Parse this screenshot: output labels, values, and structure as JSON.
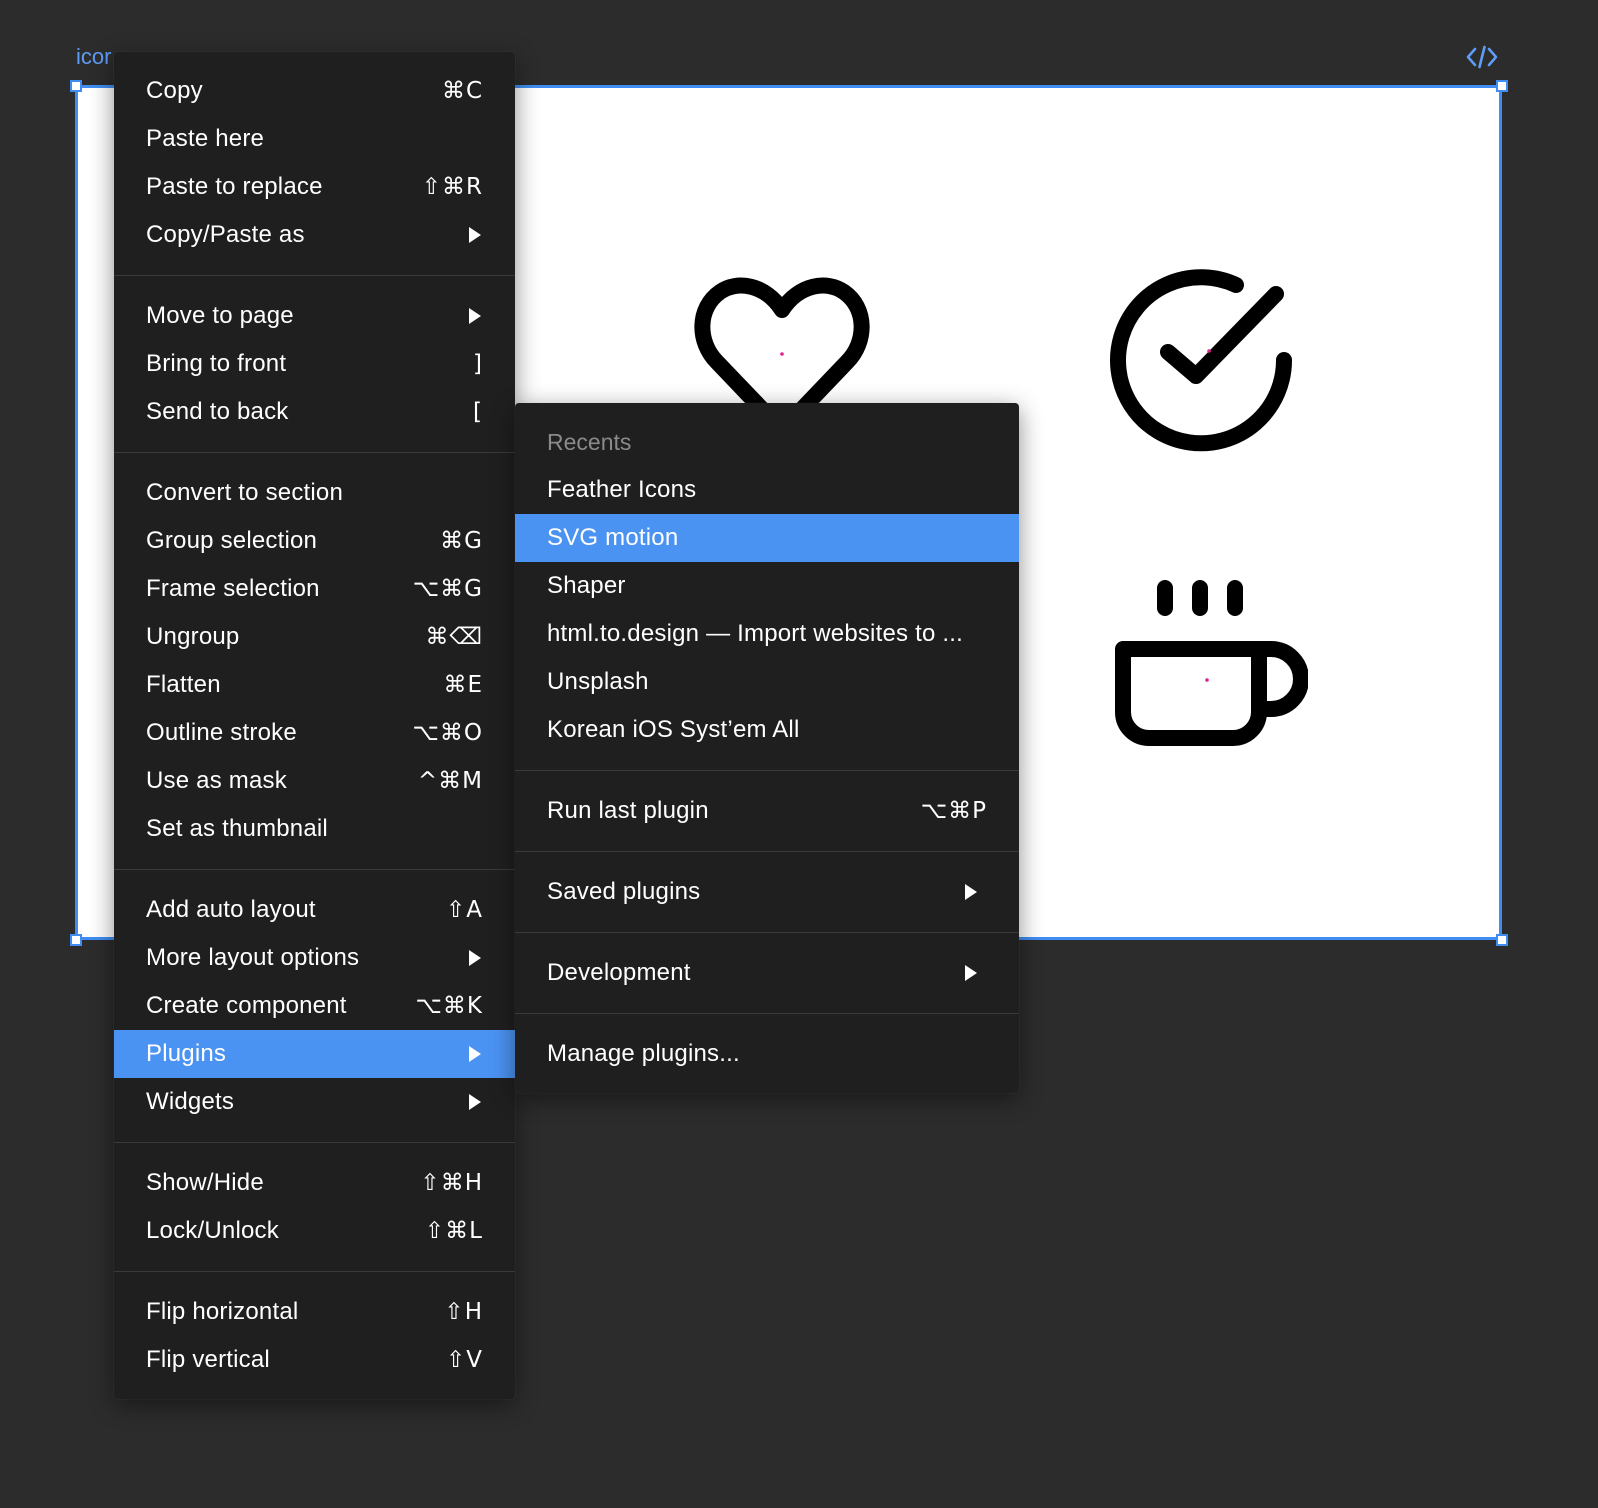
{
  "frame": {
    "label": "icor",
    "code_icon": "code-icon",
    "icons": [
      "heart-icon",
      "check-circle-icon",
      "coffee-icon"
    ]
  },
  "context_menu": {
    "groups": [
      [
        {
          "label": "Copy",
          "shortcut": "⌘C"
        },
        {
          "label": "Paste here",
          "shortcut": ""
        },
        {
          "label": "Paste to replace",
          "shortcut": "⇧⌘R"
        },
        {
          "label": "Copy/Paste as",
          "submenu": true
        }
      ],
      [
        {
          "label": "Move to page",
          "submenu": true
        },
        {
          "label": "Bring to front",
          "shortcut": "]"
        },
        {
          "label": "Send to back",
          "shortcut": "["
        }
      ],
      [
        {
          "label": "Convert to section",
          "shortcut": ""
        },
        {
          "label": "Group selection",
          "shortcut": "⌘G"
        },
        {
          "label": "Frame selection",
          "shortcut": "⌥⌘G"
        },
        {
          "label": "Ungroup",
          "shortcut": "⌘⌫"
        },
        {
          "label": "Flatten",
          "shortcut": "⌘E"
        },
        {
          "label": "Outline stroke",
          "shortcut": "⌥⌘O"
        },
        {
          "label": "Use as mask",
          "shortcut": "^⌘M"
        },
        {
          "label": "Set as thumbnail",
          "shortcut": ""
        }
      ],
      [
        {
          "label": "Add auto layout",
          "shortcut": "⇧A"
        },
        {
          "label": "More layout options",
          "submenu": true
        },
        {
          "label": "Create component",
          "shortcut": "⌥⌘K"
        },
        {
          "label": "Plugins",
          "submenu": true,
          "active": true
        },
        {
          "label": "Widgets",
          "submenu": true
        }
      ],
      [
        {
          "label": "Show/Hide",
          "shortcut": "⇧⌘H"
        },
        {
          "label": "Lock/Unlock",
          "shortcut": "⇧⌘L"
        }
      ],
      [
        {
          "label": "Flip horizontal",
          "shortcut": "⇧H"
        },
        {
          "label": "Flip vertical",
          "shortcut": "⇧V"
        }
      ]
    ]
  },
  "plugins_menu": {
    "recents_heading": "Recents",
    "recents": [
      {
        "label": "Feather Icons"
      },
      {
        "label": "SVG motion",
        "active": true
      },
      {
        "label": "Shaper"
      },
      {
        "label": "html.to.design — Import websites to ..."
      },
      {
        "label": "Unsplash"
      },
      {
        "label": "Korean iOS Syst’em All"
      }
    ],
    "groups": [
      [
        {
          "label": "Run last plugin",
          "shortcut": "⌥⌘P"
        }
      ],
      [
        {
          "label": "Saved plugins",
          "submenu": true
        }
      ],
      [
        {
          "label": "Development",
          "submenu": true
        }
      ],
      [
        {
          "label": "Manage plugins...",
          "shortcut": ""
        }
      ]
    ]
  },
  "colors": {
    "canvas": "#2c2c2c",
    "menu_bg": "#1f1f1f",
    "highlight": "#4b93f2",
    "selection": "#3f8cf2"
  }
}
